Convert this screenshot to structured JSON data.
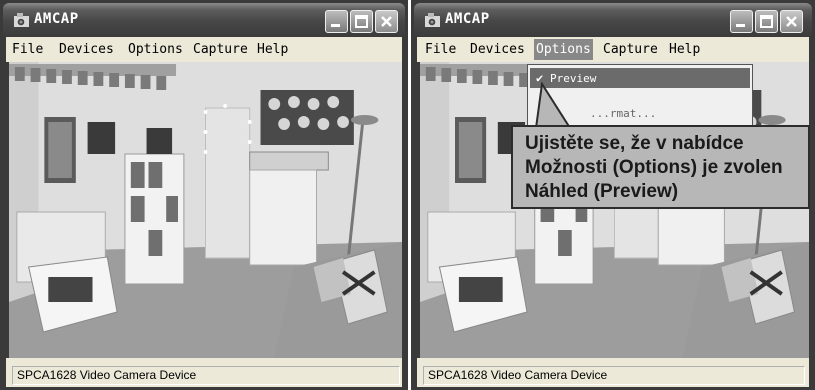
{
  "windows": [
    {
      "title": "AMCAP",
      "menu": [
        "File",
        "Devices",
        "Options",
        "Capture",
        "Help"
      ],
      "status": "SPCA1628 Video Camera Device"
    },
    {
      "title": "AMCAP",
      "menu": [
        "File",
        "Devices",
        "Options",
        "Capture",
        "Help"
      ],
      "status": "SPCA1628 Video Camera Device",
      "open_menu": "Options",
      "dropdown": {
        "items": [
          {
            "label": "Preview",
            "checked": true
          },
          {
            "label": "...rmat..."
          }
        ]
      }
    }
  ],
  "callout": {
    "lines": [
      "Ujistěte se, že v nabídce",
      "Možnosti (Options) je zvolen",
      "Náhled (Preview)"
    ]
  },
  "colors": {
    "titlebar": "#474747",
    "menubar": "#ece9d8",
    "highlight": "#6b6b6b",
    "callout_bg": "#b7b7b7"
  },
  "icons": [
    "camera-app-icon",
    "minimize-icon",
    "maximize-icon",
    "close-icon",
    "checkmark-icon"
  ]
}
